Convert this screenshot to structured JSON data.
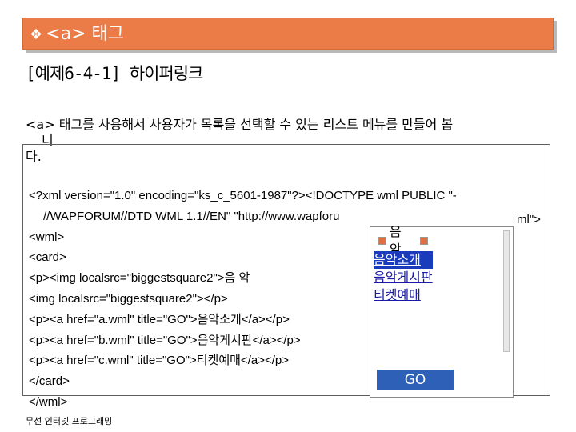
{
  "slide": {
    "title": "<a> 태그",
    "bullet_icon": "diamond-bullet-icon",
    "subtitle": "[예제6-4-1] 하이퍼링크",
    "description": [
      "<a> 태그를 사용해서 사용자가 목록을 선택할 수 있는 리스트 메뉴를 만들어 봅",
      "니",
      "다."
    ],
    "code_lines": [
      "<?xml version=\"1.0\" encoding=\"ks_c_5601-1987\"?><!DOCTYPE wml PUBLIC \"-",
      "//WAPFORUM//DTD WML 1.1//EN\" \"http://www.wapforu",
      "<wml>",
      "<card>",
      "<p><img localsrc=\"biggestsquare2\">음 악",
      "<img localsrc=\"biggestsquare2\"></p>",
      "<p><a href=\"a.wml\" title=\"GO\">음악소개</a></p>",
      "<p><a href=\"b.wml\" title=\"GO\">음악게시판</a></p>",
      "<p><a href=\"c.wml\" title=\"GO\">티켓예매</a></p>",
      "</card>",
      "</wml>"
    ],
    "code_line2_tail": "ml\">",
    "footer": "무선 인터넷 프로그래밍"
  },
  "phone": {
    "header": "음 악",
    "menu": [
      "음악소개",
      "음악게시판",
      "티켓예매"
    ],
    "softkey": "GO"
  }
}
